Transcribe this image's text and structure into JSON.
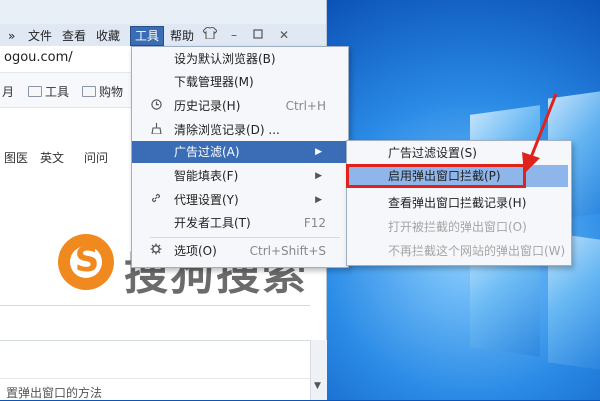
{
  "browser": {
    "menubar": {
      "items": [
        "»",
        "文件",
        "查看",
        "收藏",
        "工具",
        "帮助"
      ],
      "active": "工具"
    },
    "address": "ogou.com/",
    "favorites": [
      {
        "label": "月",
        "folder": false
      },
      {
        "label": "工具",
        "folder": true
      },
      {
        "label": "购物",
        "folder": true
      }
    ],
    "nav_links": [
      "图医",
      "英文",
      "问问"
    ],
    "logo_text": "搜狗搜索",
    "logo_letter": "S",
    "bottom_text": "置弹出窗口的方法"
  },
  "tools_menu": {
    "items": [
      {
        "label": "设为默认浏览器(B)",
        "icon": "",
        "shortcut": "",
        "submenu": false
      },
      {
        "label": "下载管理器(M)",
        "icon": "",
        "shortcut": "",
        "submenu": false
      },
      {
        "label": "历史记录(H)",
        "icon": "clock-icon",
        "shortcut": "Ctrl+H",
        "submenu": false
      },
      {
        "label": "清除浏览记录(D) ...",
        "icon": "broom-icon",
        "shortcut": "",
        "submenu": false
      },
      {
        "label": "广告过滤(A)",
        "icon": "",
        "shortcut": "",
        "submenu": true,
        "highlighted": true
      },
      {
        "label": "智能填表(F)",
        "icon": "",
        "shortcut": "",
        "submenu": true
      },
      {
        "label": "代理设置(Y)",
        "icon": "link-icon",
        "shortcut": "",
        "submenu": true
      },
      {
        "label": "开发者工具(T)",
        "icon": "",
        "shortcut": "F12",
        "submenu": false
      },
      {
        "label": "选项(O)",
        "icon": "gear-icon",
        "shortcut": "Ctrl+Shift+S",
        "submenu": false
      }
    ]
  },
  "ad_filter_submenu": {
    "items": [
      {
        "label": "广告过滤设置(S)",
        "disabled": false
      },
      {
        "label": "启用弹出窗口拦截(P)",
        "disabled": false,
        "highlighted": true
      },
      {
        "label": "查看弹出窗口拦截记录(H)",
        "disabled": false
      },
      {
        "label": "打开被拦截的弹出窗口(O)",
        "disabled": true
      },
      {
        "label": "不再拦截这个网站的弹出窗口(W)",
        "disabled": true
      }
    ]
  },
  "colors": {
    "menu_highlight": "#3b6db6",
    "submenu_highlight": "#8fb6ea",
    "annotation_red": "#e0221d",
    "logo_orange": "#f08a1e"
  }
}
